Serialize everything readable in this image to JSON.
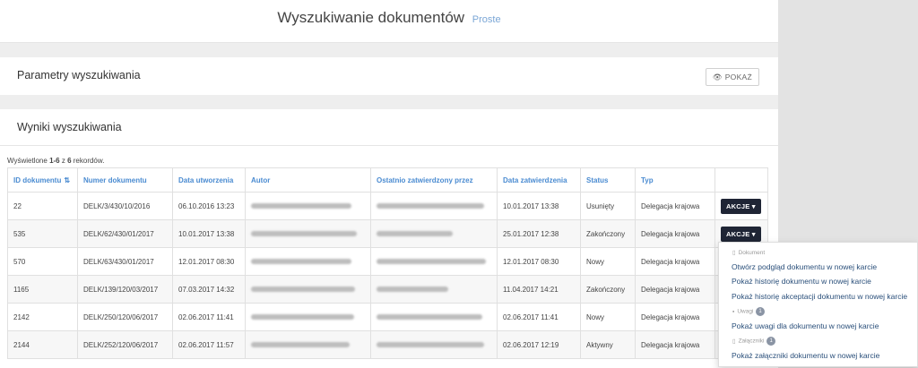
{
  "header": {
    "title": "Wyszukiwanie dokumentów",
    "subtitle": "Proste"
  },
  "params": {
    "title": "Parametry wyszukiwania",
    "show_label": "POKAŻ"
  },
  "results": {
    "title": "Wyniki wyszukiwania",
    "count_prefix": "Wyświetlone ",
    "count_range": "1-6",
    "count_mid": " z ",
    "count_total": "6",
    "count_suffix": " rekordów.",
    "columns": [
      "ID dokumentu",
      "Numer dokumentu",
      "Data utworzenia",
      "Autor",
      "Ostatnio zatwierdzony przez",
      "Data zatwierdzenia",
      "Status",
      "Typ"
    ],
    "rows": [
      {
        "id": "22",
        "numer": "DELK/3/430/10/2016",
        "data_utw": "06.10.2016 13:23",
        "data_zatw": "10.01.2017 13:38",
        "status": "Usunięty",
        "typ": "Delegacja krajowa"
      },
      {
        "id": "535",
        "numer": "DELK/62/430/01/2017",
        "data_utw": "10.01.2017 13:38",
        "data_zatw": "25.01.2017 12:38",
        "status": "Zakończony",
        "typ": "Delegacja krajowa"
      },
      {
        "id": "570",
        "numer": "DELK/63/430/01/2017",
        "data_utw": "12.01.2017 08:30",
        "data_zatw": "12.01.2017 08:30",
        "status": "Nowy",
        "typ": "Delegacja krajowa"
      },
      {
        "id": "1165",
        "numer": "DELK/139/120/03/2017",
        "data_utw": "07.03.2017 14:32",
        "data_zatw": "11.04.2017 14:21",
        "status": "Zakończony",
        "typ": "Delegacja krajowa"
      },
      {
        "id": "2142",
        "numer": "DELK/250/120/06/2017",
        "data_utw": "02.06.2017 11:41",
        "data_zatw": "02.06.2017 11:41",
        "status": "Nowy",
        "typ": "Delegacja krajowa"
      },
      {
        "id": "2144",
        "numer": "DELK/252/120/06/2017",
        "data_utw": "02.06.2017 11:57",
        "data_zatw": "02.06.2017 12:19",
        "status": "Aktywny",
        "typ": "Delegacja krajowa"
      }
    ],
    "actions_label": "AKCJE"
  },
  "menu": {
    "doc_header": "Dokument",
    "open_preview": "Otwórz podgląd dokumentu w nowej karcie",
    "show_history": "Pokaż historię dokumentu w nowej karcie",
    "show_accept_history": "Pokaż historię akceptacji dokumentu w nowej karcie",
    "notes_header": "Uwagi",
    "notes_count": "1",
    "show_notes": "Pokaż uwagi dla dokumentu w nowej karcie",
    "attachments_header": "Załączniki",
    "attachments_count": "1",
    "show_attachments": "Pokaż załączniki dokumentu w nowej karcie"
  },
  "colors": {
    "accent": "#4a8bd1",
    "button_dark": "#1f2535",
    "menu_link": "#2a4f7a"
  },
  "icons": {
    "eye": "eye-icon",
    "sort": "sort-numeric-icon",
    "caret": "caret-down-icon",
    "file": "file-icon",
    "comment": "comment-icon",
    "paperclip": "attachment-icon"
  }
}
